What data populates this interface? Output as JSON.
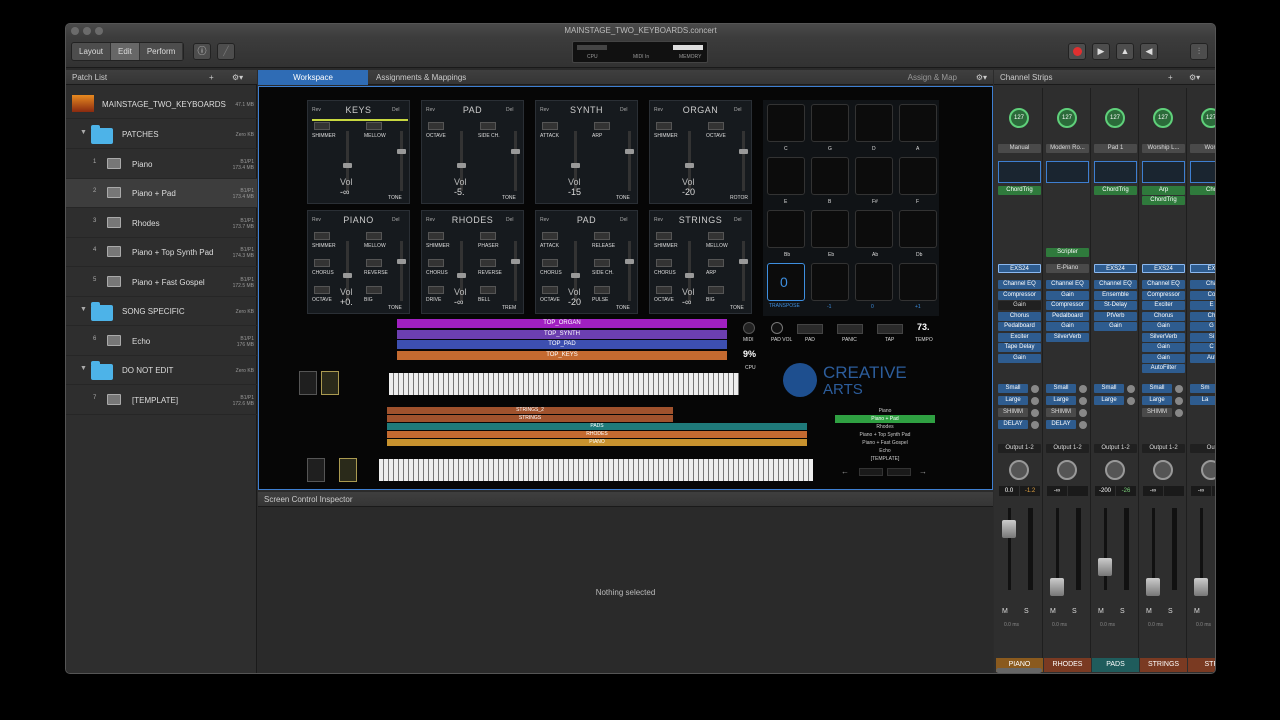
{
  "window_title": "MAINSTAGE_TWO_KEYBOARDS.concert",
  "toolbar": {
    "modes": [
      {
        "label": "Layout"
      },
      {
        "label": "Edit"
      },
      {
        "label": "Perform"
      }
    ],
    "meters": {
      "cpu": "CPU",
      "midi_in": "MIDI In",
      "memory": "MEMORY"
    }
  },
  "patch_list": {
    "title": "Patch List",
    "concert": {
      "name": "MAINSTAGE_TWO_KEYBOARDS",
      "size": "47.1 MB"
    },
    "rows": [
      {
        "type": "folder",
        "name": "PATCHES",
        "size": "Zero KB"
      },
      {
        "type": "patch",
        "num": "1",
        "name": "Piano",
        "bank": "B1/P1",
        "size": "173.4 MB"
      },
      {
        "type": "patch",
        "num": "2",
        "name": "Piano + Pad",
        "bank": "B1/P1",
        "size": "173.4 MB"
      },
      {
        "type": "patch",
        "num": "3",
        "name": "Rhodes",
        "bank": "B1/P1",
        "size": "173.7 MB"
      },
      {
        "type": "patch",
        "num": "4",
        "name": "Piano + Top Synth Pad",
        "bank": "B1/P1",
        "size": "174.3 MB"
      },
      {
        "type": "patch",
        "num": "5",
        "name": "Piano + Fast Gospel",
        "bank": "B1/P1",
        "size": "172.5 MB"
      },
      {
        "type": "folder",
        "name": "SONG SPECIFIC",
        "size": "Zero KB"
      },
      {
        "type": "patch",
        "num": "6",
        "name": "Echo",
        "bank": "B1/P1",
        "size": "176 MB"
      },
      {
        "type": "folder",
        "name": "DO NOT EDIT",
        "size": "Zero KB"
      },
      {
        "type": "patch",
        "num": "7",
        "name": "[TEMPLATE]",
        "bank": "B1/P1",
        "size": "172.6 MB"
      }
    ]
  },
  "tabs": {
    "workspace": "Workspace",
    "assignments": "Assignments & Mappings",
    "assign_map": "Assign & Map"
  },
  "modules_top": [
    {
      "title": "KEYS",
      "l1": "SHIMMER",
      "l2": "MELLOW",
      "vol": "-∞",
      "right": "TONE"
    },
    {
      "title": "PAD",
      "l1": "OCTAVE",
      "l2": "SIDE CH.",
      "vol": "-5.",
      "right": "TONE"
    },
    {
      "title": "SYNTH",
      "l1": "ATTACK",
      "l2": "ARP",
      "vol": "-15",
      "right": "TONE"
    },
    {
      "title": "ORGAN",
      "l1": "SHIMMER",
      "l2": "OCTAVE",
      "vol": "-20",
      "right": "ROTOR"
    }
  ],
  "modules_bot": [
    {
      "title": "PIANO",
      "l1": "SHIMMER",
      "l2": "MELLOW",
      "l3": "CHORUS",
      "l4": "REVERSE",
      "l5": "OCTAVE",
      "l6": "BIG",
      "vol": "+0.",
      "right": "TONE"
    },
    {
      "title": "RHODES",
      "l1": "SHIMMER",
      "l2": "PHASER",
      "l3": "CHORUS",
      "l4": "REVERSE",
      "l5": "DRIVE",
      "l6": "BELL",
      "vol": "-∞",
      "right": "TREM"
    },
    {
      "title": "PAD",
      "l1": "ATTACK",
      "l2": "RELEASE",
      "l3": "CHORUS",
      "l4": "SIDE CH.",
      "l5": "OCTAVE",
      "l6": "PULSE",
      "vol": "-20",
      "right": "TONE"
    },
    {
      "title": "STRINGS",
      "l1": "SHIMMER",
      "l2": "MELLOW",
      "l3": "CHORUS",
      "l4": "ARP",
      "l5": "OCTAVE",
      "l6": "BIG",
      "vol": "-∞",
      "right": "TONE"
    }
  ],
  "vol_label": "Vol",
  "pads": {
    "row1": [
      "C",
      "G",
      "D",
      "A"
    ],
    "row2": [
      "E",
      "B",
      "F#",
      "F"
    ],
    "row3": [
      "Bb",
      "Eb",
      "Ab",
      "Db"
    ],
    "row4": [
      "-1",
      "0",
      "+1"
    ],
    "value": "0",
    "transpose": "TRANSPOSE"
  },
  "controls": {
    "midi": "MIDI",
    "pad_vol": "PAD\nVOL",
    "pad": "PAD",
    "panic": "PANIC",
    "tap": "TAP",
    "tempo": "TEMPO",
    "tempo_val": "73.",
    "cpu": "CPU",
    "cpu_val": "9%"
  },
  "top_layers": [
    {
      "name": "TOP_ORGAN",
      "color": "#a020c0"
    },
    {
      "name": "TOP_SYNTH",
      "color": "#6c3fb0"
    },
    {
      "name": "TOP_PAD",
      "color": "#3d4fb0"
    },
    {
      "name": "TOP_KEYS",
      "color": "#c46a30"
    }
  ],
  "bottom_layers": [
    {
      "name": "STRINGS_2",
      "color": "#a0522d"
    },
    {
      "name": "STRINGS",
      "color": "#a0522d"
    },
    {
      "name": "PADS",
      "color": "#1f7a7a"
    },
    {
      "name": "RHODES",
      "color": "#c46a30"
    },
    {
      "name": "PIANO",
      "color": "#c8922e"
    }
  ],
  "logo": {
    "line1": "CREATIVE",
    "line2": "ARTS"
  },
  "mini_patches": [
    "Piano",
    "Piano + Pad",
    "Rhodes",
    "Piano + Top Synth Pad",
    "Piano + Fast Gospel",
    "Echo",
    "[TEMPLATE]"
  ],
  "inspector": {
    "title": "Screen Control Inspector",
    "empty": "Nothing selected"
  },
  "channel_strips": {
    "title": "Channel Strips",
    "strips": [
      {
        "knob": "127",
        "setting": "Manual",
        "midi_fx": [
          "ChordTrig"
        ],
        "inst": "EXS24",
        "fx": [
          "Channel EQ",
          "Compressor",
          "Gain",
          "Chorus",
          "Pedalboard",
          "Exciter",
          "Tape Delay",
          "Gain"
        ],
        "sends": [
          "Small",
          "Large",
          "SHIMM",
          "DELAY"
        ],
        "output": "Output 1-2",
        "pan_a": "0.0",
        "pan_b": "-1.2",
        "name": "PIANO",
        "color": "#8a5a1e"
      },
      {
        "knob": "127",
        "setting": "Modern Ro...",
        "midi_fx": [
          "Scripter"
        ],
        "inst": "E-Piano",
        "fx": [
          "Channel EQ",
          "Gain",
          "Compressor",
          "Pedalboard",
          "Gain",
          "SilverVerb"
        ],
        "sends": [
          "Small",
          "Large",
          "SHIMM",
          "DELAY"
        ],
        "output": "Output 1-2",
        "pan_a": "-∞",
        "pan_b": "",
        "name": "RHODES",
        "color": "#7a3a22"
      },
      {
        "knob": "127",
        "setting": "Pad 1",
        "midi_fx": [
          "ChordTrig"
        ],
        "inst": "EXS24",
        "fx": [
          "Channel EQ",
          "Ensemble",
          "St-Delay",
          "PtVerb",
          "Gain"
        ],
        "sends": [
          "Small",
          "Large"
        ],
        "output": "Output 1-2",
        "pan_a": "-200",
        "pan_b": "-26",
        "name": "PADS",
        "color": "#1f5c5c"
      },
      {
        "knob": "127",
        "setting": "Worship L...",
        "midi_fx": [
          "Arp",
          "ChordTrig"
        ],
        "inst": "EXS24",
        "fx": [
          "Channel EQ",
          "Compressor",
          "Exciter",
          "Chorus",
          "Gain",
          "SilverVerb",
          "Gain",
          "Gain",
          "AutoFilter"
        ],
        "sends": [
          "Small",
          "Large",
          "SHIMM"
        ],
        "output": "Output 1-2",
        "pan_a": "-∞",
        "pan_b": "",
        "name": "STRINGS",
        "color": "#7a3a22"
      },
      {
        "knob": "127",
        "setting": "Wors",
        "midi_fx": [
          "Cho"
        ],
        "inst": "EX",
        "fx": [
          "Cha",
          "Co",
          "E",
          "Ch",
          "G",
          "Si",
          "C",
          "Aut"
        ],
        "sends": [
          "Sm",
          "La"
        ],
        "output": "Out",
        "pan_a": "-∞",
        "pan_b": "",
        "name": "STR",
        "color": "#7a3a22"
      }
    ],
    "ms": [
      "M",
      "S"
    ],
    "ms_time": "0.0 ms"
  },
  "colors": {
    "accent": "#3e7fd1",
    "knob_green": "#5fd07a",
    "highlight_green": "#2fa042"
  }
}
